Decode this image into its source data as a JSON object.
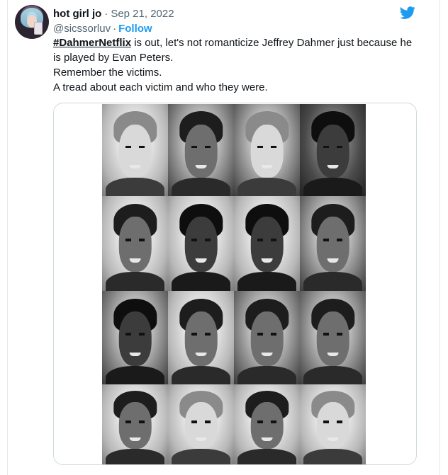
{
  "tweet": {
    "author": {
      "display_name": "hot girl jo",
      "handle": "@sicssorluv",
      "avatar_icon": "profile-photo"
    },
    "separator": "·",
    "date": "Sep 21, 2022",
    "follow_separator": "·",
    "follow_label": "Follow",
    "hashtag": "#DahmerNetflix",
    "text_line1_rest": " is out, let's not romanticize Jeffrey Dahmer just because he is played by Evan Peters.",
    "text_line2": "Remember the victims.",
    "text_line3": "A tread about each victim and who they were.",
    "brand_icon": "twitter-bird-icon",
    "brand_color": "#1d9bf0",
    "accent_color": "#1d9bf0"
  },
  "media": {
    "type": "photo-grid",
    "rows": 4,
    "columns": 4,
    "portraits": [
      {
        "tone": "light",
        "bg": "bg-light"
      },
      {
        "tone": "mid",
        "bg": ""
      },
      {
        "tone": "light",
        "bg": ""
      },
      {
        "tone": "dark",
        "bg": "bg-dark"
      },
      {
        "tone": "mid",
        "bg": "bg-light"
      },
      {
        "tone": "dark",
        "bg": "bg-light"
      },
      {
        "tone": "dark",
        "bg": "bg-light"
      },
      {
        "tone": "mid",
        "bg": ""
      },
      {
        "tone": "dark",
        "bg": ""
      },
      {
        "tone": "mid",
        "bg": "bg-light"
      },
      {
        "tone": "mid",
        "bg": ""
      },
      {
        "tone": "mid",
        "bg": ""
      },
      {
        "tone": "mid",
        "bg": "bg-light"
      },
      {
        "tone": "light",
        "bg": "bg-light"
      },
      {
        "tone": "mid",
        "bg": "bg-light"
      },
      {
        "tone": "light",
        "bg": "bg-light"
      }
    ]
  }
}
